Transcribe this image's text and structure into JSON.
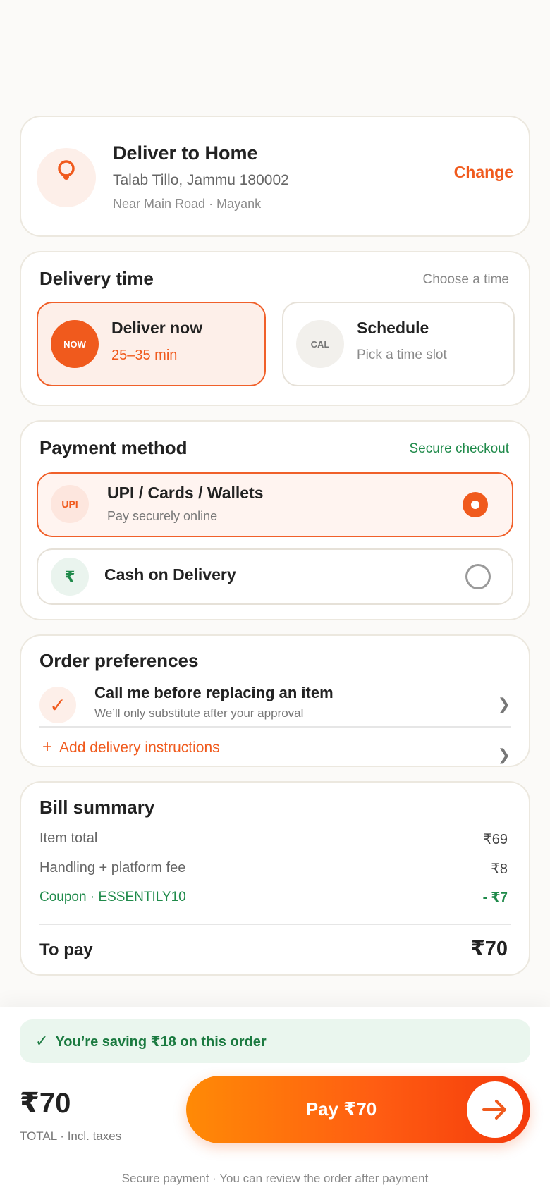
{
  "address": {
    "title": "Deliver to Home",
    "line1": "Talab Tillo, Jammu 180002",
    "line2": "Near Main Road · Mayank",
    "change_label": "Change",
    "icon": "location-pin-icon"
  },
  "delivery_time": {
    "title": "Delivery time",
    "hint": "Choose a time",
    "options": [
      {
        "badge": "NOW",
        "label": "Deliver now",
        "sub": "25–35 min",
        "selected": true
      },
      {
        "badge": "CAL",
        "label": "Schedule",
        "sub": "Pick a time slot",
        "selected": false
      }
    ]
  },
  "payment": {
    "title": "Payment method",
    "secure_label": "Secure checkout",
    "methods": [
      {
        "badge": "UPI",
        "label": "UPI / Cards / Wallets",
        "sub": "Pay securely online",
        "selected": true
      },
      {
        "badge": "₹",
        "label": "Cash on Delivery",
        "selected": false
      }
    ]
  },
  "preferences": {
    "title": "Order preferences",
    "item_label": "Call me before replacing an item",
    "item_sub": "We’ll only substitute after your approval",
    "add_plus": "+",
    "add_label": "Add delivery instructions",
    "check": "✓",
    "chevron": "❯"
  },
  "bill": {
    "title": "Bill summary",
    "rows": [
      {
        "label": "Item total",
        "amount": "₹69"
      },
      {
        "label": "Handling + platform fee",
        "amount": "₹8"
      },
      {
        "label": "Coupon · ESSENTILY10",
        "amount": "- ₹7"
      }
    ],
    "to_pay_label": "To pay",
    "to_pay_amount": "₹70"
  },
  "footer": {
    "saving_tick": "✓",
    "saving_text": "You’re saving ₹18 on this order",
    "total": "₹70",
    "total_sub": "TOTAL · Incl. taxes",
    "pay_label": "Pay ₹70",
    "note": "Secure payment · You can review the order after payment"
  },
  "colors": {
    "accent": "#f05a1d",
    "success": "#1f8a4a",
    "card_border": "#ece8df"
  }
}
